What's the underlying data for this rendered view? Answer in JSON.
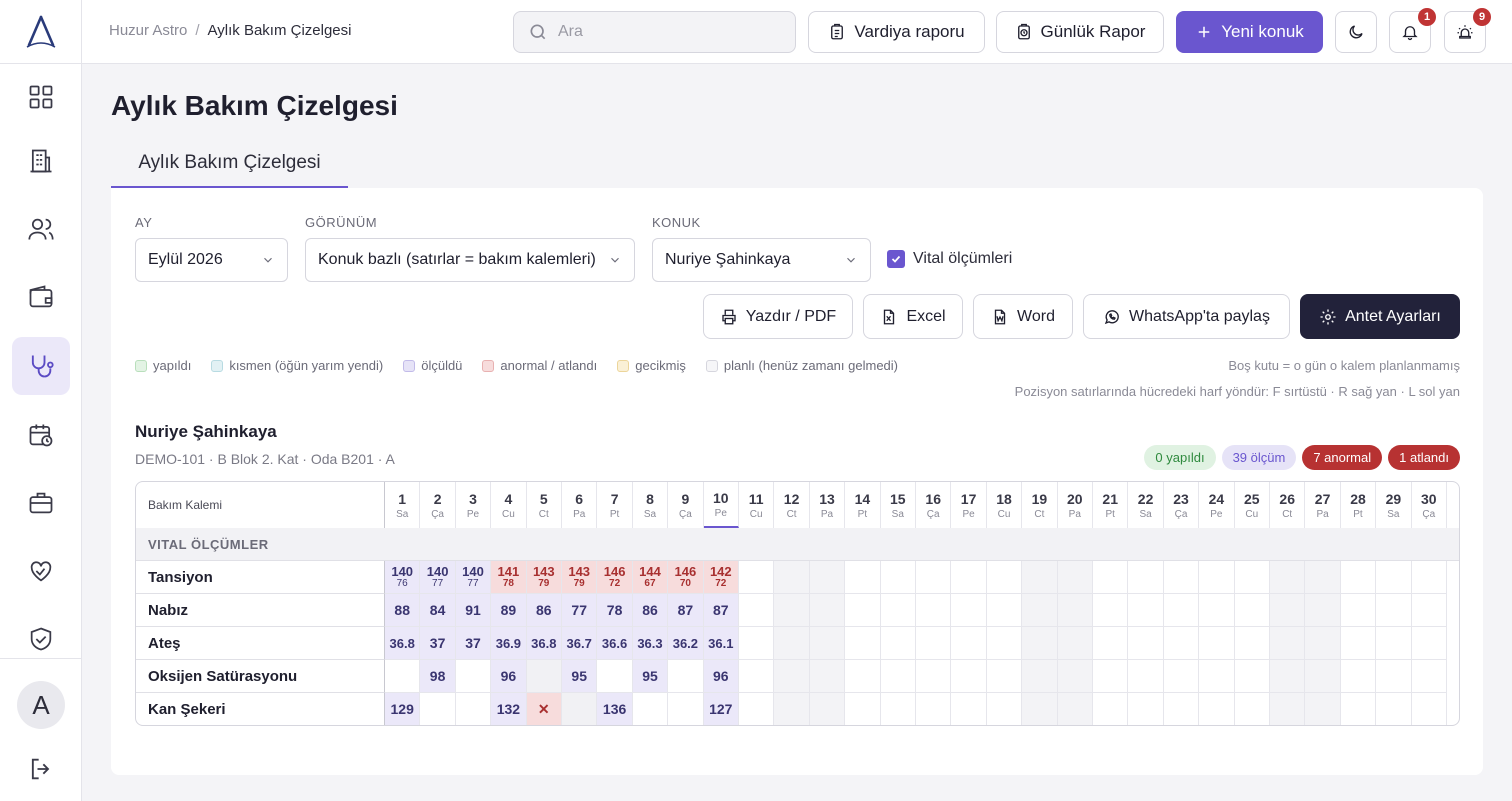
{
  "breadcrumb": {
    "root": "Huzur Astro",
    "separator": "/",
    "current": "Aylık Bakım Çizelgesi"
  },
  "search": {
    "placeholder": "Ara"
  },
  "header_buttons": {
    "shift_report": "Vardiya raporu",
    "daily_report": "Günlük Rapor",
    "new_guest": "Yeni konuk",
    "notifications_count": "1",
    "alerts_count": "9"
  },
  "page": {
    "title": "Aylık Bakım Çizelgesi",
    "tab": "Aylık Bakım Çizelgesi"
  },
  "filters": {
    "month_label": "AY",
    "month_value": "Eylül 2026",
    "view_label": "GÖRÜNÜM",
    "view_value": "Konuk bazlı (satırlar = bakım kalemleri)",
    "guest_label": "KONUK",
    "guest_value": "Nuriye Şahinkaya",
    "vitals_label": "Vital ölçümleri"
  },
  "actions": {
    "print": "Yazdır / PDF",
    "excel": "Excel",
    "word": "Word",
    "whatsapp": "WhatsApp'ta paylaş",
    "letterhead": "Antet Ayarları"
  },
  "legend": [
    {
      "label": "yapıldı",
      "bg": "#e3f3e4",
      "border": "#b9dfbc"
    },
    {
      "label": "kısmen (öğün yarım yendi)",
      "bg": "#e2f1f4",
      "border": "#b8dbe2"
    },
    {
      "label": "ölçüldü",
      "bg": "#e6e3f7",
      "border": "#c2bbe9"
    },
    {
      "label": "anormal / atlandı",
      "bg": "#f7dcdc",
      "border": "#e8b1b1"
    },
    {
      "label": "gecikmiş",
      "bg": "#faf0d6",
      "border": "#ecd59a"
    },
    {
      "label": "planlı (henüz zamanı gelmedi)",
      "bg": "#f6f6f8",
      "border": "#d6d6de"
    }
  ],
  "notes": {
    "empty": "Boş kutu = o gün o kalem planlanmamış",
    "position": "Pozisyon satırlarında hücredeki harf yöndür: F sırtüstü · R sağ yan · L sol yan"
  },
  "resident": {
    "name": "Nuriye Şahinkaya",
    "details": "DEMO-101 · B Blok 2. Kat · Oda B201 · A"
  },
  "stats": {
    "done": "0 yapıldı",
    "measured": "39 ölçüm",
    "abnormal": "7 anormal",
    "skipped": "1 atlandı"
  },
  "colors": {
    "accent": "#6a56cf",
    "dark": "#22223a",
    "measured_bg": "#ebe8f9",
    "abnormal_bg": "#f7dcdc",
    "abnormal_text": "#a83030"
  },
  "grid": {
    "label_header": "Bakım Kalemi",
    "section": "VITAL ÖLÇÜMLER",
    "today": 10,
    "weekend_days": [
      12,
      13,
      19,
      20,
      26,
      27
    ],
    "days": [
      {
        "n": "1",
        "w": "Sa"
      },
      {
        "n": "2",
        "w": "Ça"
      },
      {
        "n": "3",
        "w": "Pe"
      },
      {
        "n": "4",
        "w": "Cu"
      },
      {
        "n": "5",
        "w": "Ct"
      },
      {
        "n": "6",
        "w": "Pa"
      },
      {
        "n": "7",
        "w": "Pt"
      },
      {
        "n": "8",
        "w": "Sa"
      },
      {
        "n": "9",
        "w": "Ça"
      },
      {
        "n": "10",
        "w": "Pe"
      },
      {
        "n": "11",
        "w": "Cu"
      },
      {
        "n": "12",
        "w": "Ct"
      },
      {
        "n": "13",
        "w": "Pa"
      },
      {
        "n": "14",
        "w": "Pt"
      },
      {
        "n": "15",
        "w": "Sa"
      },
      {
        "n": "16",
        "w": "Ça"
      },
      {
        "n": "17",
        "w": "Pe"
      },
      {
        "n": "18",
        "w": "Cu"
      },
      {
        "n": "19",
        "w": "Ct"
      },
      {
        "n": "20",
        "w": "Pa"
      },
      {
        "n": "21",
        "w": "Pt"
      },
      {
        "n": "22",
        "w": "Sa"
      },
      {
        "n": "23",
        "w": "Ça"
      },
      {
        "n": "24",
        "w": "Pe"
      },
      {
        "n": "25",
        "w": "Cu"
      },
      {
        "n": "26",
        "w": "Ct"
      },
      {
        "n": "27",
        "w": "Pa"
      },
      {
        "n": "28",
        "w": "Pt"
      },
      {
        "n": "29",
        "w": "Sa"
      },
      {
        "n": "30",
        "w": "Ça"
      }
    ],
    "rows": [
      {
        "label": "Tansiyon",
        "cells": [
          {
            "s": "m",
            "v": "140",
            "v2": "76"
          },
          {
            "s": "m",
            "v": "140",
            "v2": "77"
          },
          {
            "s": "m",
            "v": "140",
            "v2": "77"
          },
          {
            "s": "a",
            "v": "141",
            "v2": "78"
          },
          {
            "s": "a",
            "v": "143",
            "v2": "79"
          },
          {
            "s": "a",
            "v": "143",
            "v2": "79"
          },
          {
            "s": "a",
            "v": "146",
            "v2": "72"
          },
          {
            "s": "a",
            "v": "144",
            "v2": "67"
          },
          {
            "s": "a",
            "v": "146",
            "v2": "70"
          },
          {
            "s": "a",
            "v": "142",
            "v2": "72"
          }
        ]
      },
      {
        "label": "Nabız",
        "cells": [
          {
            "s": "m",
            "v": "88"
          },
          {
            "s": "m",
            "v": "84"
          },
          {
            "s": "m",
            "v": "91"
          },
          {
            "s": "m",
            "v": "89"
          },
          {
            "s": "m",
            "v": "86"
          },
          {
            "s": "m",
            "v": "77"
          },
          {
            "s": "m",
            "v": "78"
          },
          {
            "s": "m",
            "v": "86"
          },
          {
            "s": "m",
            "v": "87"
          },
          {
            "s": "m",
            "v": "87"
          }
        ]
      },
      {
        "label": "Ateş",
        "cells": [
          {
            "s": "m",
            "v": "36.8"
          },
          {
            "s": "m",
            "v": "37"
          },
          {
            "s": "m",
            "v": "37"
          },
          {
            "s": "m",
            "v": "36.9"
          },
          {
            "s": "m",
            "v": "36.8"
          },
          {
            "s": "m",
            "v": "36.7"
          },
          {
            "s": "m",
            "v": "36.6"
          },
          {
            "s": "m",
            "v": "36.3"
          },
          {
            "s": "m",
            "v": "36.2"
          },
          {
            "s": "m",
            "v": "36.1"
          }
        ]
      },
      {
        "label": "Oksijen Satürasyonu",
        "cells": [
          {
            "s": "e"
          },
          {
            "s": "m",
            "v": "98"
          },
          {
            "s": "e"
          },
          {
            "s": "m",
            "v": "96"
          },
          {
            "s": "p"
          },
          {
            "s": "m",
            "v": "95"
          },
          {
            "s": "e"
          },
          {
            "s": "m",
            "v": "95"
          },
          {
            "s": "e"
          },
          {
            "s": "m",
            "v": "96"
          }
        ]
      },
      {
        "label": "Kan Şekeri",
        "cells": [
          {
            "s": "m",
            "v": "129"
          },
          {
            "s": "e"
          },
          {
            "s": "e"
          },
          {
            "s": "m",
            "v": "132"
          },
          {
            "s": "a",
            "v": "✕"
          },
          {
            "s": "p"
          },
          {
            "s": "m",
            "v": "136"
          },
          {
            "s": "e"
          },
          {
            "s": "e"
          },
          {
            "s": "m",
            "v": "127"
          }
        ]
      }
    ]
  }
}
